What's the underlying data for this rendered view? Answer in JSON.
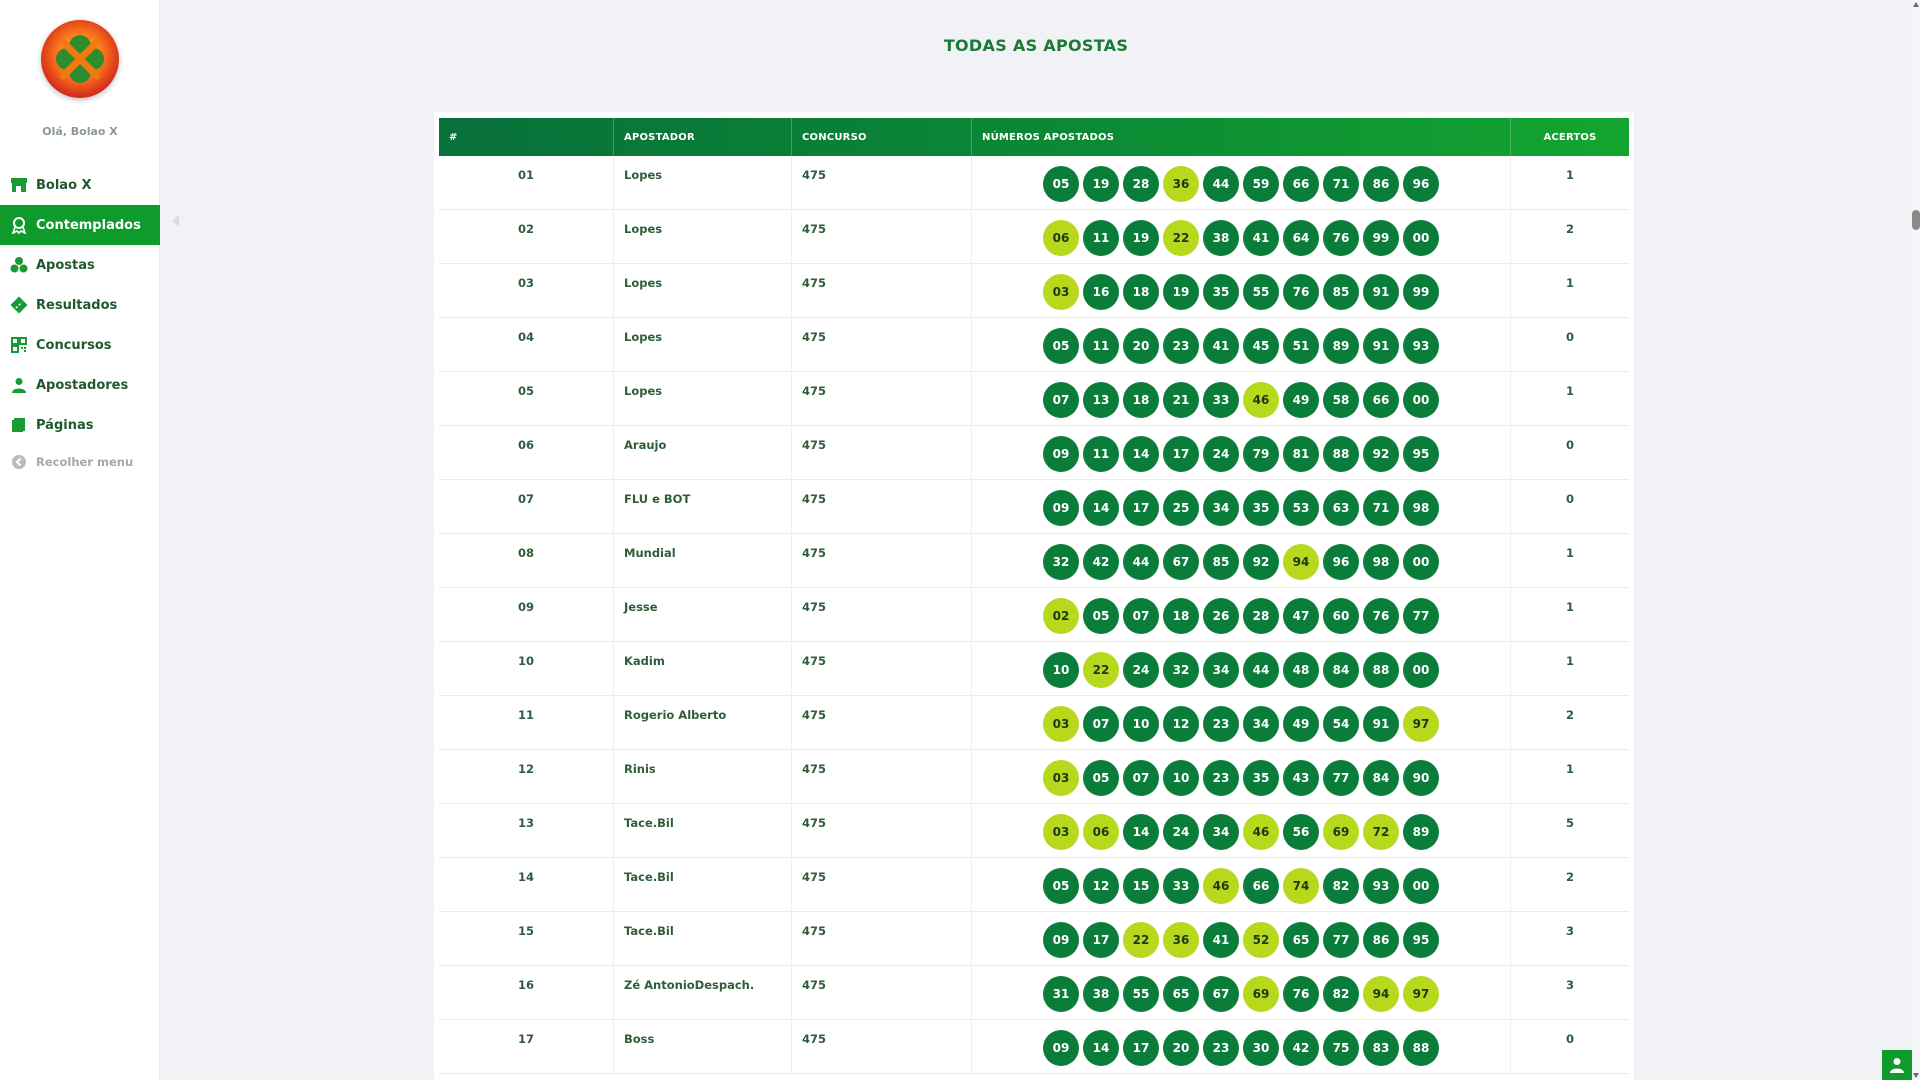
{
  "sidebar": {
    "greeting": "Olá, Bolao X",
    "items": [
      {
        "label": "Bolao X",
        "icon": "store-icon"
      },
      {
        "label": "Contemplados",
        "icon": "award-icon",
        "active": true
      },
      {
        "label": "Apostas",
        "icon": "clover-icon"
      },
      {
        "label": "Resultados",
        "icon": "ticket-icon"
      },
      {
        "label": "Concursos",
        "icon": "qrcode-icon"
      },
      {
        "label": "Apostadores",
        "icon": "user-icon"
      },
      {
        "label": "Páginas",
        "icon": "book-icon"
      }
    ],
    "collapse_label": "Recolher menu"
  },
  "page": {
    "title": "TODAS AS APOSTAS"
  },
  "table": {
    "headers": [
      "#",
      "APOSTADOR",
      "CONCURSO",
      "NÚMEROS APOSTADOS",
      "ACERTOS"
    ],
    "rows": [
      {
        "n": "01",
        "apostador": "Lopes",
        "concurso": "475",
        "acertos": "1",
        "numeros": [
          {
            "v": "05",
            "h": false
          },
          {
            "v": "19",
            "h": false
          },
          {
            "v": "28",
            "h": false
          },
          {
            "v": "36",
            "h": true
          },
          {
            "v": "44",
            "h": false
          },
          {
            "v": "59",
            "h": false
          },
          {
            "v": "66",
            "h": false
          },
          {
            "v": "71",
            "h": false
          },
          {
            "v": "86",
            "h": false
          },
          {
            "v": "96",
            "h": false
          }
        ]
      },
      {
        "n": "02",
        "apostador": "Lopes",
        "concurso": "475",
        "acertos": "2",
        "numeros": [
          {
            "v": "06",
            "h": true
          },
          {
            "v": "11",
            "h": false
          },
          {
            "v": "19",
            "h": false
          },
          {
            "v": "22",
            "h": true
          },
          {
            "v": "38",
            "h": false
          },
          {
            "v": "41",
            "h": false
          },
          {
            "v": "64",
            "h": false
          },
          {
            "v": "76",
            "h": false
          },
          {
            "v": "99",
            "h": false
          },
          {
            "v": "00",
            "h": false
          }
        ]
      },
      {
        "n": "03",
        "apostador": "Lopes",
        "concurso": "475",
        "acertos": "1",
        "numeros": [
          {
            "v": "03",
            "h": true
          },
          {
            "v": "16",
            "h": false
          },
          {
            "v": "18",
            "h": false
          },
          {
            "v": "19",
            "h": false
          },
          {
            "v": "35",
            "h": false
          },
          {
            "v": "55",
            "h": false
          },
          {
            "v": "76",
            "h": false
          },
          {
            "v": "85",
            "h": false
          },
          {
            "v": "91",
            "h": false
          },
          {
            "v": "99",
            "h": false
          }
        ]
      },
      {
        "n": "04",
        "apostador": "Lopes",
        "concurso": "475",
        "acertos": "0",
        "numeros": [
          {
            "v": "05",
            "h": false
          },
          {
            "v": "11",
            "h": false
          },
          {
            "v": "20",
            "h": false
          },
          {
            "v": "23",
            "h": false
          },
          {
            "v": "41",
            "h": false
          },
          {
            "v": "45",
            "h": false
          },
          {
            "v": "51",
            "h": false
          },
          {
            "v": "89",
            "h": false
          },
          {
            "v": "91",
            "h": false
          },
          {
            "v": "93",
            "h": false
          }
        ]
      },
      {
        "n": "05",
        "apostador": "Lopes",
        "concurso": "475",
        "acertos": "1",
        "numeros": [
          {
            "v": "07",
            "h": false
          },
          {
            "v": "13",
            "h": false
          },
          {
            "v": "18",
            "h": false
          },
          {
            "v": "21",
            "h": false
          },
          {
            "v": "33",
            "h": false
          },
          {
            "v": "46",
            "h": true
          },
          {
            "v": "49",
            "h": false
          },
          {
            "v": "58",
            "h": false
          },
          {
            "v": "66",
            "h": false
          },
          {
            "v": "00",
            "h": false
          }
        ]
      },
      {
        "n": "06",
        "apostador": "Araujo",
        "concurso": "475",
        "acertos": "0",
        "numeros": [
          {
            "v": "09",
            "h": false
          },
          {
            "v": "11",
            "h": false
          },
          {
            "v": "14",
            "h": false
          },
          {
            "v": "17",
            "h": false
          },
          {
            "v": "24",
            "h": false
          },
          {
            "v": "79",
            "h": false
          },
          {
            "v": "81",
            "h": false
          },
          {
            "v": "88",
            "h": false
          },
          {
            "v": "92",
            "h": false
          },
          {
            "v": "95",
            "h": false
          }
        ]
      },
      {
        "n": "07",
        "apostador": "FLU e BOT",
        "concurso": "475",
        "acertos": "0",
        "numeros": [
          {
            "v": "09",
            "h": false
          },
          {
            "v": "14",
            "h": false
          },
          {
            "v": "17",
            "h": false
          },
          {
            "v": "25",
            "h": false
          },
          {
            "v": "34",
            "h": false
          },
          {
            "v": "35",
            "h": false
          },
          {
            "v": "53",
            "h": false
          },
          {
            "v": "63",
            "h": false
          },
          {
            "v": "71",
            "h": false
          },
          {
            "v": "98",
            "h": false
          }
        ]
      },
      {
        "n": "08",
        "apostador": "Mundial",
        "concurso": "475",
        "acertos": "1",
        "numeros": [
          {
            "v": "32",
            "h": false
          },
          {
            "v": "42",
            "h": false
          },
          {
            "v": "44",
            "h": false
          },
          {
            "v": "67",
            "h": false
          },
          {
            "v": "85",
            "h": false
          },
          {
            "v": "92",
            "h": false
          },
          {
            "v": "94",
            "h": true
          },
          {
            "v": "96",
            "h": false
          },
          {
            "v": "98",
            "h": false
          },
          {
            "v": "00",
            "h": false
          }
        ]
      },
      {
        "n": "09",
        "apostador": "Jesse",
        "concurso": "475",
        "acertos": "1",
        "numeros": [
          {
            "v": "02",
            "h": true
          },
          {
            "v": "05",
            "h": false
          },
          {
            "v": "07",
            "h": false
          },
          {
            "v": "18",
            "h": false
          },
          {
            "v": "26",
            "h": false
          },
          {
            "v": "28",
            "h": false
          },
          {
            "v": "47",
            "h": false
          },
          {
            "v": "60",
            "h": false
          },
          {
            "v": "76",
            "h": false
          },
          {
            "v": "77",
            "h": false
          }
        ]
      },
      {
        "n": "10",
        "apostador": "Kadim",
        "concurso": "475",
        "acertos": "1",
        "numeros": [
          {
            "v": "10",
            "h": false
          },
          {
            "v": "22",
            "h": true
          },
          {
            "v": "24",
            "h": false
          },
          {
            "v": "32",
            "h": false
          },
          {
            "v": "34",
            "h": false
          },
          {
            "v": "44",
            "h": false
          },
          {
            "v": "48",
            "h": false
          },
          {
            "v": "84",
            "h": false
          },
          {
            "v": "88",
            "h": false
          },
          {
            "v": "00",
            "h": false
          }
        ]
      },
      {
        "n": "11",
        "apostador": "Rogerio Alberto",
        "concurso": "475",
        "acertos": "2",
        "numeros": [
          {
            "v": "03",
            "h": true
          },
          {
            "v": "07",
            "h": false
          },
          {
            "v": "10",
            "h": false
          },
          {
            "v": "12",
            "h": false
          },
          {
            "v": "23",
            "h": false
          },
          {
            "v": "34",
            "h": false
          },
          {
            "v": "49",
            "h": false
          },
          {
            "v": "54",
            "h": false
          },
          {
            "v": "91",
            "h": false
          },
          {
            "v": "97",
            "h": true
          }
        ]
      },
      {
        "n": "12",
        "apostador": "Rinis",
        "concurso": "475",
        "acertos": "1",
        "numeros": [
          {
            "v": "03",
            "h": true
          },
          {
            "v": "05",
            "h": false
          },
          {
            "v": "07",
            "h": false
          },
          {
            "v": "10",
            "h": false
          },
          {
            "v": "23",
            "h": false
          },
          {
            "v": "35",
            "h": false
          },
          {
            "v": "43",
            "h": false
          },
          {
            "v": "77",
            "h": false
          },
          {
            "v": "84",
            "h": false
          },
          {
            "v": "90",
            "h": false
          }
        ]
      },
      {
        "n": "13",
        "apostador": "Tace.Bil",
        "concurso": "475",
        "acertos": "5",
        "numeros": [
          {
            "v": "03",
            "h": true
          },
          {
            "v": "06",
            "h": true
          },
          {
            "v": "14",
            "h": false
          },
          {
            "v": "24",
            "h": false
          },
          {
            "v": "34",
            "h": false
          },
          {
            "v": "46",
            "h": true
          },
          {
            "v": "56",
            "h": false
          },
          {
            "v": "69",
            "h": true
          },
          {
            "v": "72",
            "h": true
          },
          {
            "v": "89",
            "h": false
          }
        ]
      },
      {
        "n": "14",
        "apostador": "Tace.Bil",
        "concurso": "475",
        "acertos": "2",
        "numeros": [
          {
            "v": "05",
            "h": false
          },
          {
            "v": "12",
            "h": false
          },
          {
            "v": "15",
            "h": false
          },
          {
            "v": "33",
            "h": false
          },
          {
            "v": "46",
            "h": true
          },
          {
            "v": "66",
            "h": false
          },
          {
            "v": "74",
            "h": true
          },
          {
            "v": "82",
            "h": false
          },
          {
            "v": "93",
            "h": false
          },
          {
            "v": "00",
            "h": false
          }
        ]
      },
      {
        "n": "15",
        "apostador": "Tace.Bil",
        "concurso": "475",
        "acertos": "3",
        "numeros": [
          {
            "v": "09",
            "h": false
          },
          {
            "v": "17",
            "h": false
          },
          {
            "v": "22",
            "h": true
          },
          {
            "v": "36",
            "h": true
          },
          {
            "v": "41",
            "h": false
          },
          {
            "v": "52",
            "h": true
          },
          {
            "v": "65",
            "h": false
          },
          {
            "v": "77",
            "h": false
          },
          {
            "v": "86",
            "h": false
          },
          {
            "v": "95",
            "h": false
          }
        ]
      },
      {
        "n": "16",
        "apostador": "Zé AntonioDespach.",
        "concurso": "475",
        "acertos": "3",
        "numeros": [
          {
            "v": "31",
            "h": false
          },
          {
            "v": "38",
            "h": false
          },
          {
            "v": "55",
            "h": false
          },
          {
            "v": "65",
            "h": false
          },
          {
            "v": "67",
            "h": false
          },
          {
            "v": "69",
            "h": true
          },
          {
            "v": "76",
            "h": false
          },
          {
            "v": "82",
            "h": false
          },
          {
            "v": "94",
            "h": true
          },
          {
            "v": "97",
            "h": true
          }
        ]
      },
      {
        "n": "17",
        "apostador": "Boss",
        "concurso": "475",
        "acertos": "0",
        "numeros": [
          {
            "v": "09",
            "h": false
          },
          {
            "v": "14",
            "h": false
          },
          {
            "v": "17",
            "h": false
          },
          {
            "v": "20",
            "h": false
          },
          {
            "v": "23",
            "h": false
          },
          {
            "v": "30",
            "h": false
          },
          {
            "v": "42",
            "h": false
          },
          {
            "v": "75",
            "h": false
          },
          {
            "v": "83",
            "h": false
          },
          {
            "v": "88",
            "h": false
          }
        ]
      }
    ]
  },
  "colors": {
    "brand_green": "#0f9a2c",
    "ball_green": "#0b7d3a",
    "ball_hit": "#b7d81c"
  }
}
